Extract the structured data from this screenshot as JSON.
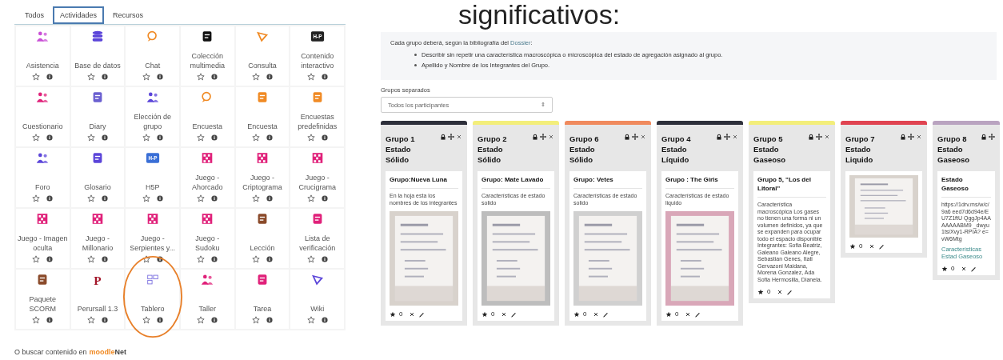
{
  "heading": "significativos:",
  "chooser": {
    "tabs": [
      {
        "label": "Todos",
        "selected": false
      },
      {
        "label": "Actividades",
        "selected": true
      },
      {
        "label": "Recursos",
        "selected": false
      }
    ],
    "activities": [
      {
        "name": "Asistencia",
        "highlighted": false
      },
      {
        "name": "Base de datos",
        "highlighted": false
      },
      {
        "name": "Chat",
        "highlighted": false
      },
      {
        "name": "Colección multimedia",
        "highlighted": false
      },
      {
        "name": "Consulta",
        "highlighted": false
      },
      {
        "name": "Contenido interactivo",
        "icon_text": "H-P",
        "highlighted": false
      },
      {
        "name": "Cuestionario",
        "highlighted": false
      },
      {
        "name": "Diary",
        "highlighted": false
      },
      {
        "name": "Elección de grupo",
        "highlighted": false
      },
      {
        "name": "Encuesta",
        "highlighted": false
      },
      {
        "name": "Encuesta",
        "highlighted": false
      },
      {
        "name": "Encuestas predefinidas",
        "highlighted": false
      },
      {
        "name": "Foro",
        "highlighted": false
      },
      {
        "name": "Glosario",
        "highlighted": false
      },
      {
        "name": "H5P",
        "icon_text": "H-P",
        "highlighted": false
      },
      {
        "name": "Juego - Ahorcado",
        "highlighted": false
      },
      {
        "name": "Juego - Criptograma",
        "highlighted": false
      },
      {
        "name": "Juego - Crucigrama",
        "highlighted": false
      },
      {
        "name": "Juego - Imagen oculta",
        "highlighted": false
      },
      {
        "name": "Juego - Millonario",
        "highlighted": false
      },
      {
        "name": "Juego - Serpientes y...",
        "highlighted": false
      },
      {
        "name": "Juego - Sudoku",
        "highlighted": false
      },
      {
        "name": "Lección",
        "highlighted": false
      },
      {
        "name": "Lista de verificación",
        "highlighted": false
      },
      {
        "name": "Paquete SCORM",
        "highlighted": false
      },
      {
        "name": "Perursall 1.3",
        "icon_text": "P",
        "highlighted": false
      },
      {
        "name": "Tablero",
        "highlighted": true
      },
      {
        "name": "Taller",
        "highlighted": false
      },
      {
        "name": "Tarea",
        "highlighted": false
      },
      {
        "name": "Wiki",
        "highlighted": false
      }
    ],
    "footer": {
      "text": "O buscar contenido en",
      "logo_a": "moodle",
      "logo_b": "Net"
    }
  },
  "board": {
    "intro": {
      "before": "Cada grupo deberá, según la bibliografía del",
      "link": "Dossier",
      "after": ":"
    },
    "bullets": [
      "Describir sin repetir una característica macroscópica o microscópica del estado de agregación asignado al grupo.",
      "Apellido y Nombre de los Integrantes del Grupo."
    ],
    "filter_label": "Grupos separados",
    "filter_value": "Todos los participantes",
    "filter_caret": "⇕",
    "columns": [
      {
        "title": [
          "Grupo 1",
          "Estado",
          "Sólido"
        ],
        "color": "#2d2f3a",
        "show_close": true,
        "cards": [
          {
            "heading": "Grupo:Nueva Luna",
            "body": "En la hoja esta los nombres de los integrantes",
            "picture": true,
            "rating": "0"
          }
        ]
      },
      {
        "title": [
          "Grupo 2",
          "Estado",
          "Sólido"
        ],
        "color": "#f3ee7a",
        "show_close": true,
        "cards": [
          {
            "heading": "Grupo: Mate Lavado",
            "body": "Características de estado solido",
            "picture": true,
            "rating": "0"
          }
        ]
      },
      {
        "title": [
          "Grupo 6",
          "Estado",
          "Sólido"
        ],
        "color": "#f08a5d",
        "show_close": true,
        "cards": [
          {
            "heading": "Grupo: Vetes",
            "body": "Características de estado solido",
            "picture": true,
            "rating": "0"
          }
        ]
      },
      {
        "title": [
          "Grupo 4",
          "Estado",
          "Líquido"
        ],
        "color": "#2d2f3a",
        "show_close": true,
        "cards": [
          {
            "heading": "Grupo : The Girls",
            "body": "Características de estado liquido",
            "picture": true,
            "rating": "0"
          }
        ]
      },
      {
        "title": [
          "Grupo 5",
          "Estado",
          "Gaseoso"
        ],
        "color": "#f3ee7a",
        "show_close": true,
        "cards": [
          {
            "heading": "Grupo 5, \"Los del Litoral\"",
            "body": "Característica macroscópica Los gases no tienen una forma ni un volumen definidos, ya que se expanden para ocupar todo el espacio disponible Integrantes: Sofia Beatriz, Galeano Galeano Alegre, Sebastian Genes, Itati Gervazoni Maidana, Morena Gonzalez, Ada Sofia Hermosilla, Dianela.",
            "rating": "0"
          }
        ]
      },
      {
        "title": [
          "Grupo 7",
          "Estado",
          "Liquido"
        ],
        "color": "#e04451",
        "show_close": true,
        "cards": [
          {
            "picture": true,
            "rating": "0"
          }
        ]
      },
      {
        "title": [
          "Grupo 8",
          "Estado",
          "Gaseoso"
        ],
        "color": "#b9a3c0",
        "show_close": false,
        "cards": [
          {
            "heading": "Estado Gaseoso",
            "body": "https://1drv.ms/w/c/9a6 eed7d6d94e/EU7Z1ftU QggJp4AAAAAAABM9 _dwyu1tsiXvy1-RPIA? e=vW6Mtg",
            "link": "Características Estad Gaseoso",
            "rating": "0"
          }
        ]
      }
    ]
  }
}
